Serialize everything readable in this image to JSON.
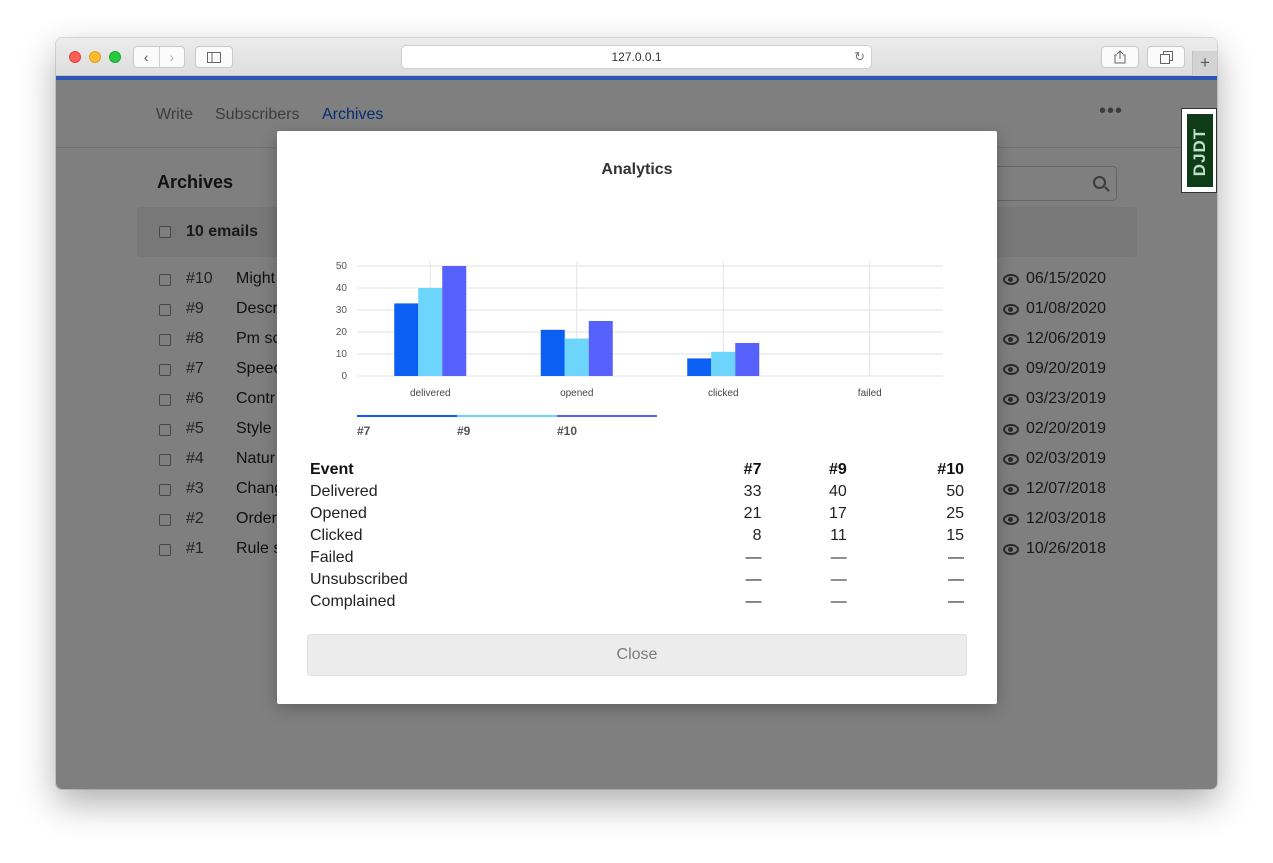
{
  "browser": {
    "url": "127.0.0.1",
    "back_icon": "chevron-left",
    "forward_icon": "chevron-right",
    "plus": "+"
  },
  "nav": {
    "items": [
      {
        "label": "Write"
      },
      {
        "label": "Subscribers"
      },
      {
        "label": "Archives"
      }
    ],
    "more": "•••"
  },
  "archives": {
    "title": "Archives",
    "count_label": "10 emails",
    "rows": [
      {
        "num": "#10",
        "subject": "Might",
        "date": "06/15/2020"
      },
      {
        "num": "#9",
        "subject": "Descr",
        "date": "01/08/2020"
      },
      {
        "num": "#8",
        "subject": "Pm sc",
        "date": "12/06/2019"
      },
      {
        "num": "#7",
        "subject": "Speec",
        "date": "09/20/2019"
      },
      {
        "num": "#6",
        "subject": "Contr",
        "date": "03/23/2019"
      },
      {
        "num": "#5",
        "subject": "Style",
        "date": "02/20/2019"
      },
      {
        "num": "#4",
        "subject": "Natur",
        "date": "02/03/2019"
      },
      {
        "num": "#3",
        "subject": "Chang",
        "date": "12/07/2018"
      },
      {
        "num": "#2",
        "subject": "Order",
        "date": "12/03/2018"
      },
      {
        "num": "#1",
        "subject": "Rule s",
        "date": "10/26/2018"
      }
    ]
  },
  "djdt": {
    "label": "DJDT"
  },
  "modal": {
    "title": "Analytics",
    "close_label": "Close",
    "table": {
      "headers": [
        "Event",
        "#7",
        "#9",
        "#10"
      ],
      "rows": [
        [
          "Delivered",
          "33",
          "40",
          "50"
        ],
        [
          "Opened",
          "21",
          "17",
          "25"
        ],
        [
          "Clicked",
          "8",
          "11",
          "15"
        ],
        [
          "Failed",
          "—",
          "—",
          "—"
        ],
        [
          "Unsubscribed",
          "—",
          "—",
          "—"
        ],
        [
          "Complained",
          "—",
          "—",
          "—"
        ]
      ]
    }
  },
  "chart_data": {
    "type": "bar",
    "categories": [
      "delivered",
      "opened",
      "clicked",
      "failed"
    ],
    "series": [
      {
        "name": "#7",
        "values": [
          33,
          21,
          8,
          0
        ],
        "color": "#0b5ff2"
      },
      {
        "name": "#9",
        "values": [
          40,
          17,
          11,
          0
        ],
        "color": "#6dd4fb"
      },
      {
        "name": "#10",
        "values": [
          50,
          25,
          15,
          0
        ],
        "color": "#5561fa"
      }
    ],
    "yticks": [
      0,
      10,
      20,
      30,
      40,
      50
    ],
    "ylim": [
      0,
      50
    ],
    "grid": true,
    "legend": "bottom-left"
  }
}
